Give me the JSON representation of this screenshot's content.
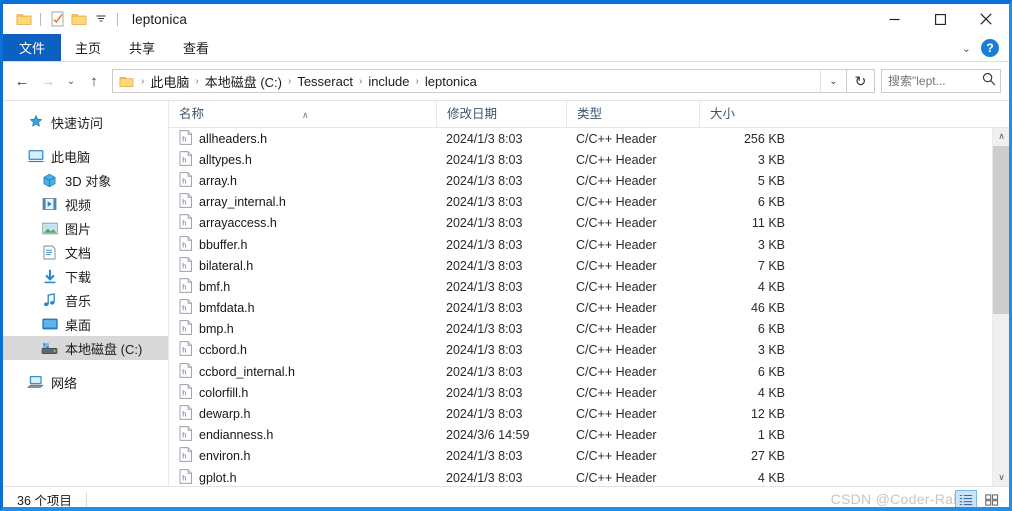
{
  "window": {
    "title": "leptonica",
    "qat_icons": [
      "folder-icon",
      "properties-icon",
      "new-folder-icon",
      "customize-qat-chevron-icon"
    ],
    "minimize_label": "─",
    "maximize_label": "□",
    "close_label": "✕"
  },
  "ribbon": {
    "tabs": [
      {
        "label": "文件",
        "name": "tab-file",
        "active": true
      },
      {
        "label": "主页",
        "name": "tab-home",
        "active": false
      },
      {
        "label": "共享",
        "name": "tab-share",
        "active": false
      },
      {
        "label": "查看",
        "name": "tab-view",
        "active": false
      }
    ],
    "collapse_chevron": "⌄",
    "help_label": "?"
  },
  "address": {
    "back": "←",
    "forward": "→",
    "recent": "⌄",
    "up": "↑",
    "crumbs": [
      "此电脑",
      "本地磁盘 (C:)",
      "Tesseract",
      "include",
      "leptonica"
    ],
    "separator": "›",
    "dropdown": "⌄",
    "refresh": "↻",
    "search_placeholder": "搜索\"lept...",
    "search_value": "",
    "search_icon": "search-icon"
  },
  "sidebar": {
    "groups": [
      {
        "items": [
          {
            "label": "快速访问",
            "icon": "star-pin-icon",
            "indent": false,
            "selected": false
          }
        ]
      },
      {
        "items": [
          {
            "label": "此电脑",
            "icon": "this-pc-icon",
            "indent": false,
            "selected": false
          },
          {
            "label": "3D 对象",
            "icon": "3d-objects-icon",
            "indent": true,
            "selected": false
          },
          {
            "label": "视频",
            "icon": "videos-icon",
            "indent": true,
            "selected": false
          },
          {
            "label": "图片",
            "icon": "pictures-icon",
            "indent": true,
            "selected": false
          },
          {
            "label": "文档",
            "icon": "documents-icon",
            "indent": true,
            "selected": false
          },
          {
            "label": "下载",
            "icon": "downloads-icon",
            "indent": true,
            "selected": false
          },
          {
            "label": "音乐",
            "icon": "music-icon",
            "indent": true,
            "selected": false
          },
          {
            "label": "桌面",
            "icon": "desktop-icon",
            "indent": true,
            "selected": false
          },
          {
            "label": "本地磁盘 (C:)",
            "icon": "local-disk-icon",
            "indent": true,
            "selected": true
          }
        ]
      },
      {
        "items": [
          {
            "label": "网络",
            "icon": "network-icon",
            "indent": false,
            "selected": false
          }
        ]
      }
    ]
  },
  "filelist": {
    "columns": [
      {
        "label": "名称",
        "name": "column-name",
        "sorted": true,
        "sort_caret": "∧"
      },
      {
        "label": "修改日期",
        "name": "column-date-modified",
        "sorted": false
      },
      {
        "label": "类型",
        "name": "column-type",
        "sorted": false
      },
      {
        "label": "大小",
        "name": "column-size",
        "sorted": false
      }
    ],
    "rows": [
      {
        "name": "allheaders.h",
        "date": "2024/1/3 8:03",
        "type": "C/C++ Header",
        "size": "256 KB"
      },
      {
        "name": "alltypes.h",
        "date": "2024/1/3 8:03",
        "type": "C/C++ Header",
        "size": "3 KB"
      },
      {
        "name": "array.h",
        "date": "2024/1/3 8:03",
        "type": "C/C++ Header",
        "size": "5 KB"
      },
      {
        "name": "array_internal.h",
        "date": "2024/1/3 8:03",
        "type": "C/C++ Header",
        "size": "6 KB"
      },
      {
        "name": "arrayaccess.h",
        "date": "2024/1/3 8:03",
        "type": "C/C++ Header",
        "size": "11 KB"
      },
      {
        "name": "bbuffer.h",
        "date": "2024/1/3 8:03",
        "type": "C/C++ Header",
        "size": "3 KB"
      },
      {
        "name": "bilateral.h",
        "date": "2024/1/3 8:03",
        "type": "C/C++ Header",
        "size": "7 KB"
      },
      {
        "name": "bmf.h",
        "date": "2024/1/3 8:03",
        "type": "C/C++ Header",
        "size": "4 KB"
      },
      {
        "name": "bmfdata.h",
        "date": "2024/1/3 8:03",
        "type": "C/C++ Header",
        "size": "46 KB"
      },
      {
        "name": "bmp.h",
        "date": "2024/1/3 8:03",
        "type": "C/C++ Header",
        "size": "6 KB"
      },
      {
        "name": "ccbord.h",
        "date": "2024/1/3 8:03",
        "type": "C/C++ Header",
        "size": "3 KB"
      },
      {
        "name": "ccbord_internal.h",
        "date": "2024/1/3 8:03",
        "type": "C/C++ Header",
        "size": "6 KB"
      },
      {
        "name": "colorfill.h",
        "date": "2024/1/3 8:03",
        "type": "C/C++ Header",
        "size": "4 KB"
      },
      {
        "name": "dewarp.h",
        "date": "2024/1/3 8:03",
        "type": "C/C++ Header",
        "size": "12 KB"
      },
      {
        "name": "endianness.h",
        "date": "2024/3/6 14:59",
        "type": "C/C++ Header",
        "size": "1 KB"
      },
      {
        "name": "environ.h",
        "date": "2024/1/3 8:03",
        "type": "C/C++ Header",
        "size": "27 KB"
      },
      {
        "name": "gplot.h",
        "date": "2024/1/3 8:03",
        "type": "C/C++ Header",
        "size": "4 KB"
      }
    ],
    "scroll_up": "∧",
    "scroll_down": "∨"
  },
  "status": {
    "item_count": "36 个项目",
    "watermark": "CSDN @Coder-Rabbit",
    "view_details_icon": "details-view-icon",
    "view_large_icon": "large-icons-view-icon"
  },
  "colors": {
    "accent": "#0078d7",
    "file_tab": "#0b60c0",
    "selection": "#cce4f7",
    "header_text": "#40546e"
  }
}
